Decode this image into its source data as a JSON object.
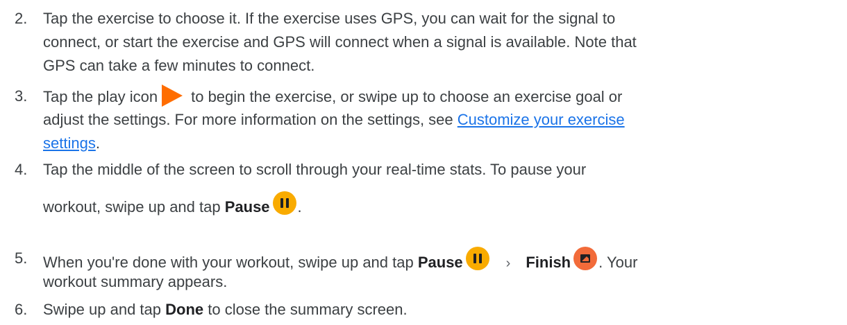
{
  "steps": [
    {
      "number": "2.",
      "lines": [
        "Tap the exercise to choose it. If the exercise uses GPS, you can wait for the signal to",
        "connect, or start the exercise and GPS will connect when a signal is available. Note that",
        "GPS can take a few minutes to connect."
      ]
    },
    {
      "number": "3.",
      "line1_before": "Tap the play icon",
      "line1_after": "to begin the exercise, or swipe up to choose an exercise goal or",
      "line2_text": "adjust the settings. For more information on the settings, see ",
      "link_part1": "Customize your exercise",
      "link_part2": "settings",
      "line3_after": "."
    },
    {
      "number": "4.",
      "line1": "Tap the middle of the screen to scroll through your real-time stats. To pause your",
      "line2_before": "workout, swipe up and tap ",
      "pause_label": "Pause",
      "line2_after": "."
    },
    {
      "number": "5.",
      "line1_before": "When you're done with your workout, swipe up and tap ",
      "pause_label": "Pause",
      "chevron": "›",
      "finish_label": "Finish",
      "line1_after": ". Your",
      "line2": "workout summary appears."
    },
    {
      "number": "6.",
      "before": "Swipe up and tap ",
      "done_label": "Done",
      "after": " to close the summary screen."
    }
  ],
  "icons": {
    "play": "play-icon",
    "pause": "pause-icon",
    "finish": "finish-icon"
  },
  "colors": {
    "text": "#3c4043",
    "link": "#1a73e8",
    "play": "#ff6d00",
    "pause_bg": "#f9ab00",
    "finish_bg": "#f26b3a"
  }
}
